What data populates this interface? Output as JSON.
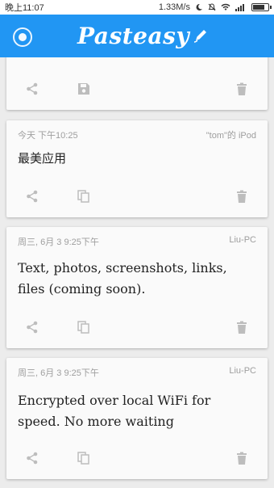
{
  "status_bar": {
    "time": "晚上11:07",
    "speed": "1.33M/s",
    "icons": [
      "moon-icon",
      "mute-icon",
      "wifi-icon",
      "signal-icon",
      "battery-icon"
    ],
    "battery_level": 0.85
  },
  "app_bar": {
    "title": "Pasteasy",
    "left_icon": "sync-icon",
    "title_icon": "pen-icon",
    "color": "#2196f3"
  },
  "cards": [
    {
      "time": "",
      "device": "",
      "content": "",
      "actions": [
        "share-icon",
        "save-icon",
        "delete-icon"
      ]
    },
    {
      "time": "今天 下午10:25",
      "device": "\"tom\"的 iPod",
      "content": "最美应用",
      "actions": [
        "share-icon",
        "copy-icon",
        "delete-icon"
      ]
    },
    {
      "time": "周三, 6月 3 9:25下午",
      "device": "Liu-PC",
      "content": "Text, photos, screenshots, links, files (coming soon).",
      "actions": [
        "share-icon",
        "copy-icon",
        "delete-icon"
      ]
    },
    {
      "time": "周三, 6月 3 9:25下午",
      "device": "Liu-PC",
      "content": "Encrypted over local WiFi for speed. No more waiting",
      "actions": [
        "share-icon",
        "copy-icon",
        "delete-icon"
      ]
    }
  ],
  "colors": {
    "app_bar": "#2196f3",
    "background": "#ececec",
    "card": "#fafafa",
    "icon": "#bdbdbd",
    "meta_text": "#9e9e9e"
  }
}
